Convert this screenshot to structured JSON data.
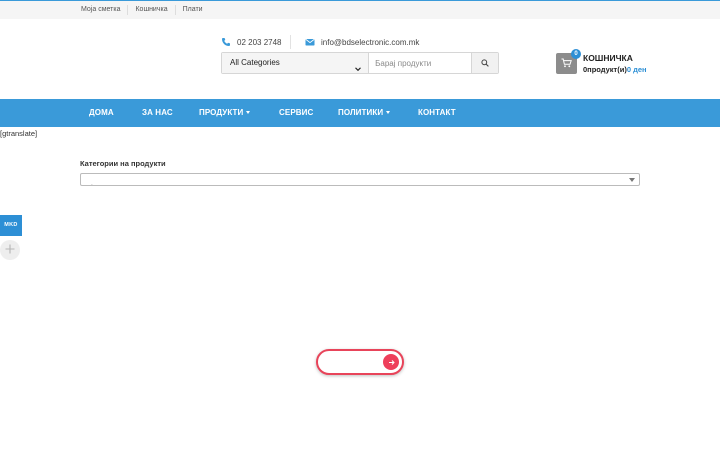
{
  "top_links": [
    "Моја сметка",
    "Кошничка",
    "Плати"
  ],
  "contact": {
    "phone": "02 203 2748",
    "email": "info@bdselectronic.com.mk"
  },
  "search": {
    "category_selected": "All Categories",
    "placeholder": "Барај продукти"
  },
  "cart": {
    "count": "0",
    "title": "КОШНИЧКА",
    "products_text": "0продукт(и)",
    "price": "0 ден"
  },
  "nav": {
    "home": "ДОМА",
    "about": "ЗА НАС",
    "products": "ПРОДУКТИ",
    "service": "СЕРВИС",
    "policies": "ПОЛИТИКИ",
    "contact": "КОНТАКТ"
  },
  "gtranslate": "[gtranslate]",
  "product_categories": {
    "label": "Категории на продукти"
  },
  "language_button": "MKD",
  "colors": {
    "nav_blue": "#3a9ad9",
    "accent_blue": "#2d8fd5",
    "pill_red": "#e8445a"
  }
}
